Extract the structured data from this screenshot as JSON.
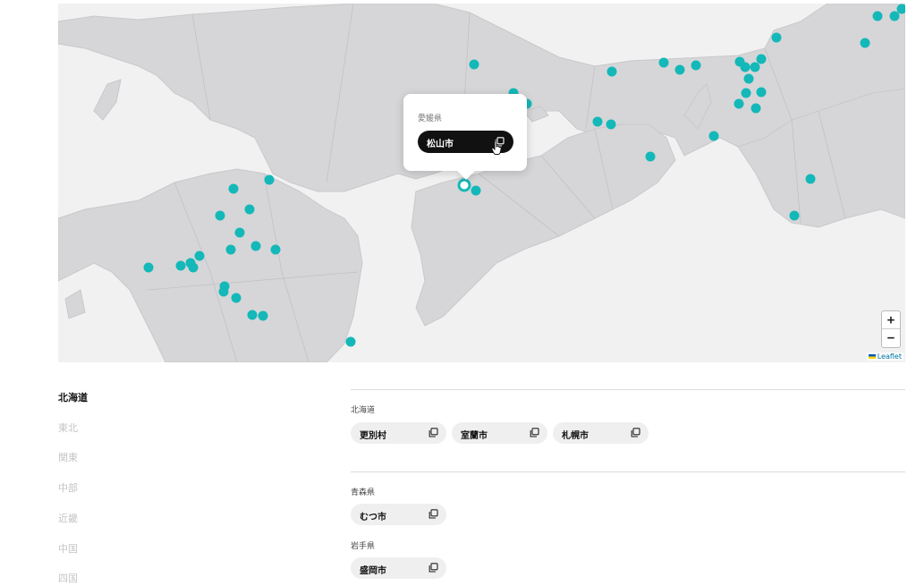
{
  "map": {
    "attribution": "Leaflet",
    "zoom_in_label": "+",
    "zoom_out_label": "−",
    "marker_color": "#14b8b8",
    "popup": {
      "prefecture": "愛媛県",
      "city": "松山市"
    }
  },
  "regions": {
    "items": [
      {
        "label": "北海道",
        "active": true
      },
      {
        "label": "東北",
        "active": false
      },
      {
        "label": "関東",
        "active": false
      },
      {
        "label": "中部",
        "active": false
      },
      {
        "label": "近畿",
        "active": false
      },
      {
        "label": "中国",
        "active": false
      },
      {
        "label": "四国",
        "active": false
      }
    ]
  },
  "prefectures": [
    {
      "name": "北海道",
      "cities": [
        "更別村",
        "室蘭市",
        "札幌市"
      ]
    },
    {
      "name": "青森県",
      "cities": [
        "むつ市"
      ]
    },
    {
      "name": "岩手県",
      "cities": [
        "盛岡市"
      ]
    }
  ]
}
